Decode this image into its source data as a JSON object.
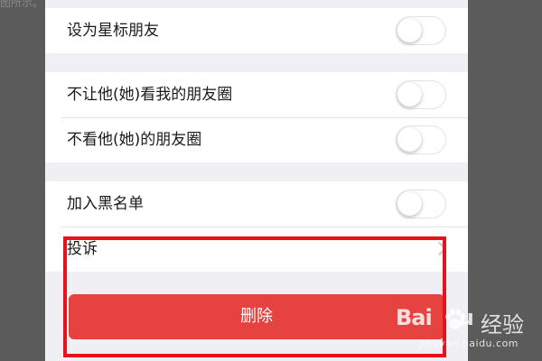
{
  "corner_text": "图所示。",
  "settings": {
    "star_friend": {
      "label": "设为星标朋友",
      "enabled": false
    },
    "hide_my_moments": {
      "label": "不让他(她)看我的朋友圈",
      "enabled": false
    },
    "hide_their_moments": {
      "label": "不看他(她)的朋友圈",
      "enabled": false
    },
    "blacklist": {
      "label": "加入黑名单",
      "enabled": false
    },
    "complain": {
      "label": "投诉"
    }
  },
  "delete_button": {
    "label": "删除"
  },
  "watermark": {
    "logo_left": "Bai",
    "logo_right": "u",
    "title": "经验",
    "url": "jingyan.baidu.com"
  },
  "colors": {
    "background": "#5b5b5b",
    "panel": "#efeff4",
    "delete_red": "#e64340",
    "highlight_red": "#e8121c"
  }
}
